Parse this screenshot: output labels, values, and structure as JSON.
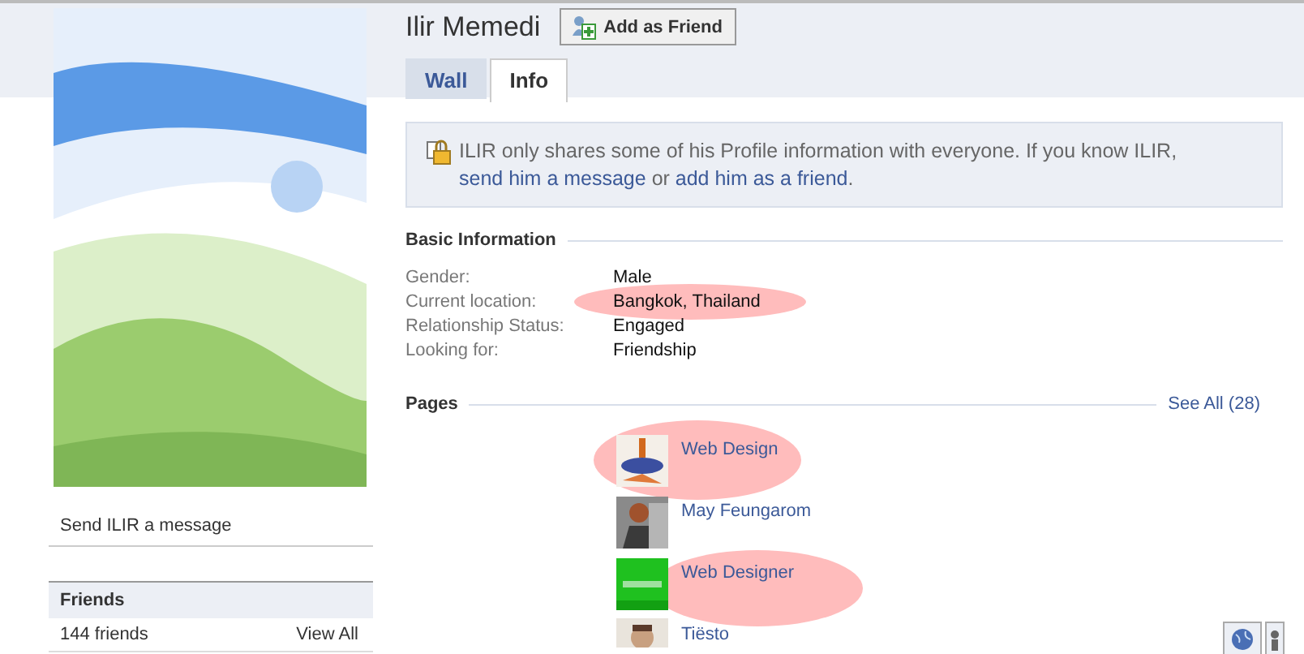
{
  "profile": {
    "name": "Ilir Memedi",
    "add_friend_button": "Add as Friend"
  },
  "sidebar": {
    "message_link": "Send ILIR a message",
    "friends": {
      "title": "Friends",
      "count": "144 friends",
      "view_all": "View All"
    }
  },
  "tabs": [
    {
      "label": "Wall",
      "selected": false
    },
    {
      "label": "Info",
      "selected": true
    }
  ],
  "notice": {
    "parts": [
      {
        "text": "ILIR only shares some of his Profile information with everyone. If you know ILIR, ",
        "link": false
      },
      {
        "text": "send him a message",
        "link": true
      },
      {
        "text": " or ",
        "link": false
      },
      {
        "text": "add him as a friend",
        "link": true
      },
      {
        "text": ".",
        "link": false
      }
    ]
  },
  "basic_information": {
    "title": "Basic Information",
    "fields": [
      {
        "label": "Gender:",
        "value": "Male",
        "highlighted": false
      },
      {
        "label": "Current location:",
        "value": "Bangkok, Thailand",
        "highlighted": true
      },
      {
        "label": "Relationship Status:",
        "value": "Engaged",
        "highlighted": false
      },
      {
        "label": "Looking for:",
        "value": "Friendship",
        "highlighted": false
      }
    ]
  },
  "pages": {
    "title": "Pages",
    "see_all": "See All (28)",
    "items": [
      {
        "name": "Web Design",
        "highlighted": true
      },
      {
        "name": "May Feungarom",
        "highlighted": false
      },
      {
        "name": "Web Designer",
        "highlighted": true
      },
      {
        "name": "Tiësto",
        "highlighted": false
      }
    ]
  }
}
